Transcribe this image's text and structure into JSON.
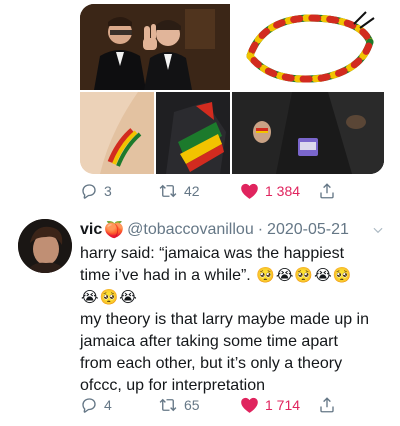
{
  "tweet1": {
    "media": {
      "icons": [
        "photo-two-men",
        "photo-rasta-bracelet",
        "photo-wrist-detail",
        "photo-rasta-shirt",
        "photo-hand-bracelet"
      ]
    },
    "actions": {
      "reply_count": "3",
      "retweet_count": "42",
      "like_count": "1 384"
    }
  },
  "tweet2": {
    "display_name": "vic",
    "name_emoji": "🍑",
    "handle": "@tobaccovanillou",
    "separator": "·",
    "date": "2020-05-21",
    "line1": "harry said: “jamaica was the happiest",
    "line2": "time i’ve had in a while”.",
    "emojis_line2": [
      "🥺",
      "😭",
      "🥺",
      "😭",
      "🥺"
    ],
    "emojis_line3": [
      "😭",
      "🥺",
      "😭"
    ],
    "paragraph": [
      "my theory is that larry maybe made up in",
      "jamaica after taking some time apart",
      "from each other, but it’s only a theory",
      "ofccc, up for interpretation"
    ],
    "actions": {
      "reply_count": "4",
      "retweet_count": "65",
      "like_count": "1 714"
    }
  },
  "colors": {
    "text": "#14171a",
    "muted": "#657786",
    "like": "#e0245e"
  }
}
